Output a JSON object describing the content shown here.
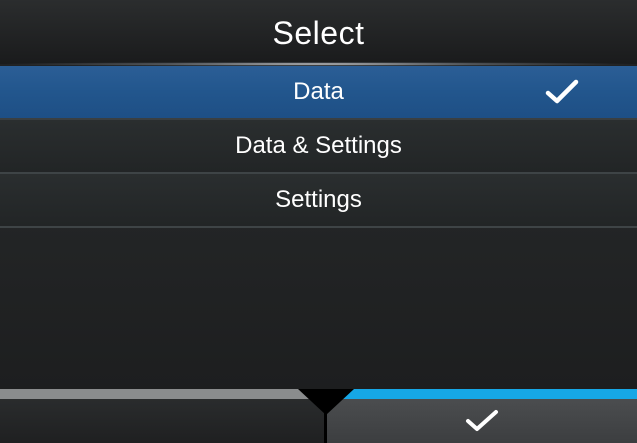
{
  "header": {
    "title": "Select"
  },
  "menu": {
    "items": [
      {
        "label": "Data",
        "selected": true
      },
      {
        "label": "Data & Settings",
        "selected": false
      },
      {
        "label": "Settings",
        "selected": false
      }
    ]
  },
  "footer": {
    "left_button_label": "",
    "confirm_icon": "check-icon",
    "left_track_color": "#8a8c8d",
    "right_track_color": "#16a7e6"
  },
  "colors": {
    "selected_row": "#22568d",
    "accent": "#16a7e6"
  }
}
